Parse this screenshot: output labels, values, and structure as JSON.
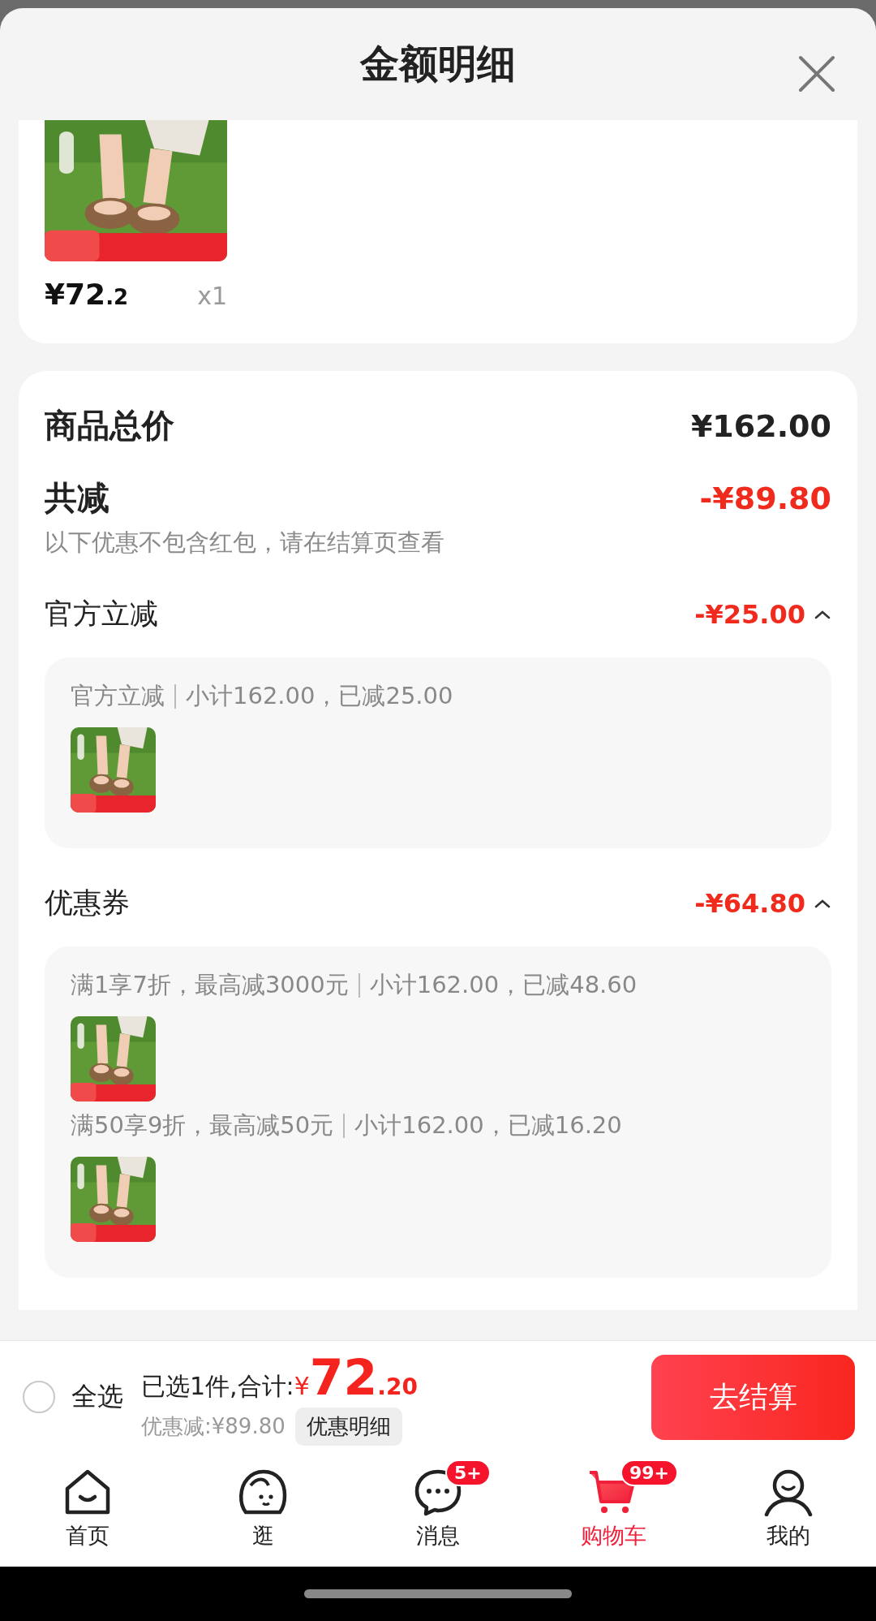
{
  "sheet": {
    "title": "金额明细"
  },
  "product": {
    "price_main": "¥72",
    "price_decimal": ".2",
    "quantity": "x1"
  },
  "summary": {
    "total_label": "商品总价",
    "total_value": "¥162.00",
    "reduction_label": "共减",
    "reduction_value": "-¥89.80",
    "note": "以下优惠不包含红包，请在结算页查看"
  },
  "discount_groups": [
    {
      "title": "官方立减",
      "amount": "-¥25.00",
      "expanded": true,
      "entries": [
        {
          "rule": "官方立减",
          "detail": "小计162.00，已减25.00"
        }
      ]
    },
    {
      "title": "优惠券",
      "amount": "-¥64.80",
      "expanded": true,
      "entries": [
        {
          "rule": "满1享7折，最高减3000元",
          "detail": "小计162.00，已减48.60"
        },
        {
          "rule": "满50享9折，最高减50元",
          "detail": "小计162.00，已减16.20"
        }
      ]
    }
  ],
  "checkout_bar": {
    "select_all": {
      "label": "全选",
      "checked": false
    },
    "selected_prefix": "已选1件,合计:",
    "currency": "¥",
    "total_main": "72",
    "total_decimal": ".20",
    "discount_text": "优惠减:¥89.80",
    "details_button": "优惠明细",
    "checkout_button": "去结算"
  },
  "tab_bar": [
    {
      "kind": "home",
      "label": "首页",
      "selected": false
    },
    {
      "kind": "browse",
      "label": "逛",
      "selected": false
    },
    {
      "kind": "messages",
      "label": "消息",
      "badge": "5+",
      "selected": false
    },
    {
      "kind": "cart",
      "label": "购物车",
      "badge": "99+",
      "selected": true
    },
    {
      "kind": "profile",
      "label": "我的",
      "selected": false
    }
  ]
}
